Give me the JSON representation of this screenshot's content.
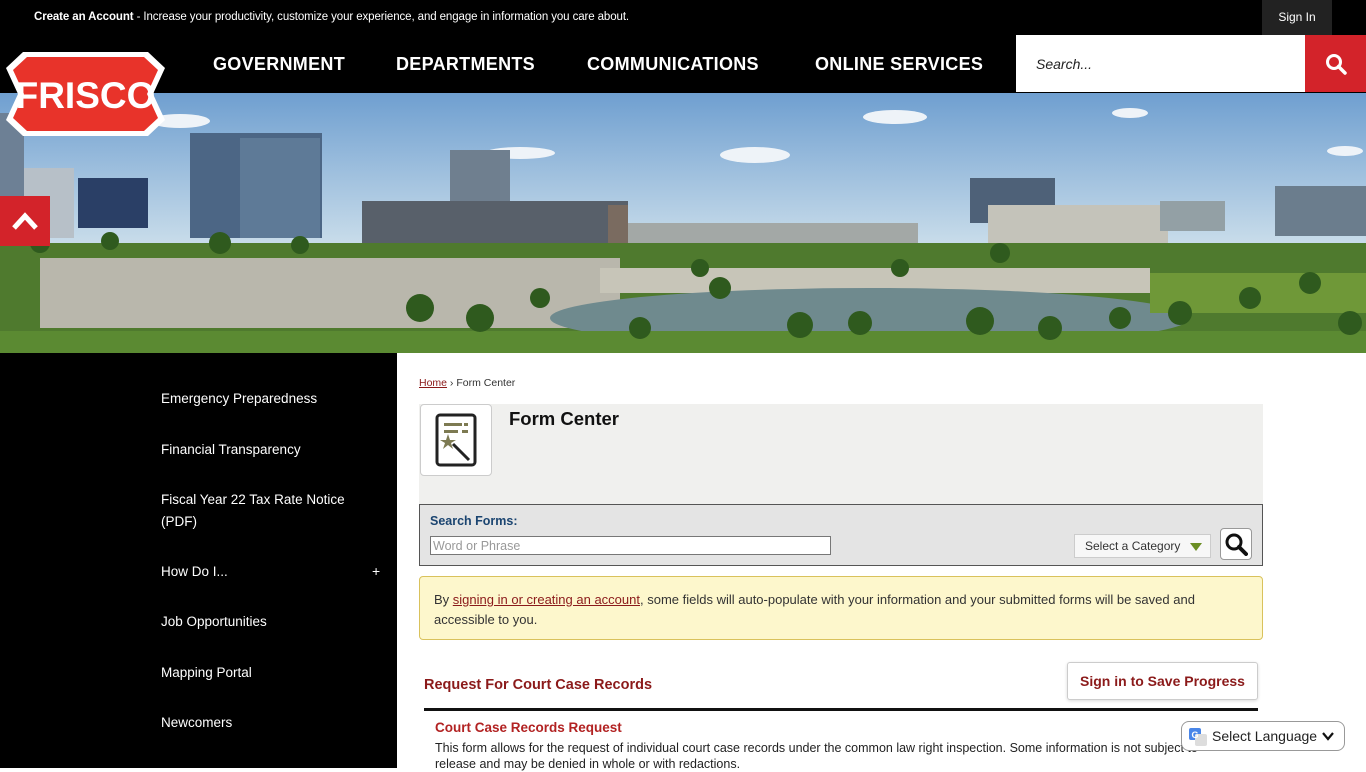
{
  "topbar": {
    "create_account": "Create an Account",
    "promo_text": " - Increase your productivity, customize your experience, and engage in information you care about.",
    "sign_in": "Sign In"
  },
  "logo": {
    "text": "FRISCO",
    "color": "#e8332a"
  },
  "nav": {
    "items": [
      "GOVERNMENT",
      "DEPARTMENTS",
      "COMMUNICATIONS",
      "ONLINE SERVICES"
    ],
    "search_placeholder": "Search..."
  },
  "sidebar": {
    "items": [
      "Emergency Preparedness",
      "Financial Transparency",
      "Fiscal Year 22 Tax Rate Notice (PDF)",
      "How Do I...",
      "Job Opportunities",
      "Mapping Portal",
      "Newcomers"
    ],
    "expand_symbol": "+"
  },
  "breadcrumb": {
    "home": "Home",
    "separator": " › ",
    "current": "Form Center"
  },
  "page": {
    "title": "Form Center"
  },
  "form_search": {
    "label": "Search Forms:",
    "placeholder": "Word or Phrase",
    "category_label": "Select a Category"
  },
  "notice": {
    "prefix": "By ",
    "link": "signing in or creating an account",
    "suffix": ", some fields will auto-populate with your information and your submitted forms will be saved and accessible to you."
  },
  "category": {
    "title": "Request For Court Case Records",
    "save_button": "Sign in to Save Progress",
    "forms": [
      {
        "title": "Court Case Records Request",
        "description": "This form allows for the request of individual court case records under the common law right inspection. Some information is not subject to release and may be denied in whole or with redactions."
      }
    ]
  },
  "language": {
    "label": "Select Language"
  },
  "colors": {
    "accent_red": "#d3232a",
    "link_maroon": "#8b1a1a",
    "nav_bg": "#000000"
  }
}
